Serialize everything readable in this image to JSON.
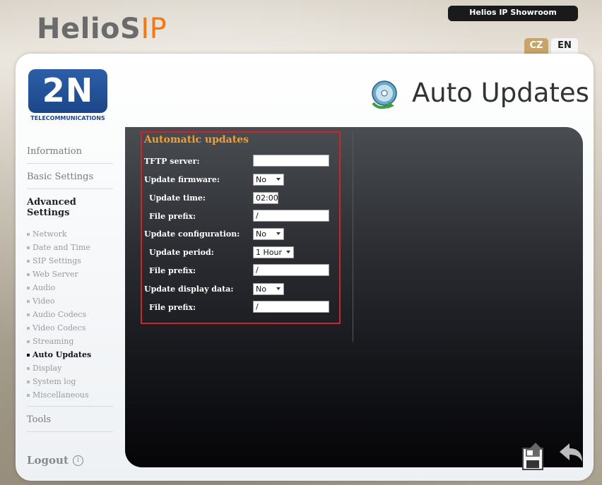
{
  "header": {
    "brand_main": "HelioS",
    "brand_ip": "IP",
    "device_name": "Helios IP Showroom",
    "languages": [
      {
        "code": "CZ",
        "active": false
      },
      {
        "code": "EN",
        "active": true
      }
    ]
  },
  "logo": {
    "text": "2N",
    "subtitle": "TELECOMMUNICATIONS"
  },
  "page": {
    "title": "Auto Updates",
    "title_icon": "cd-update-icon"
  },
  "nav": {
    "main": [
      {
        "label": "Information",
        "active": false
      },
      {
        "label": "Basic Settings",
        "active": false
      },
      {
        "label": "Advanced Settings",
        "active": true
      }
    ],
    "sub": [
      {
        "label": "Network",
        "active": false
      },
      {
        "label": "Date and Time",
        "active": false
      },
      {
        "label": "SIP Settings",
        "active": false
      },
      {
        "label": "Web Server",
        "active": false
      },
      {
        "label": "Audio",
        "active": false
      },
      {
        "label": "Video",
        "active": false
      },
      {
        "label": "Audio Codecs",
        "active": false
      },
      {
        "label": "Video Codecs",
        "active": false
      },
      {
        "label": "Streaming",
        "active": false
      },
      {
        "label": "Auto Updates",
        "active": true
      },
      {
        "label": "Display",
        "active": false
      },
      {
        "label": "System log",
        "active": false
      },
      {
        "label": "Miscellaneous",
        "active": false
      }
    ],
    "tools": "Tools",
    "logout": "Logout"
  },
  "form": {
    "heading": "Automatic updates",
    "tftp_server": {
      "label": "TFTP server:",
      "value": ""
    },
    "update_firmware": {
      "label": "Update firmware:",
      "value": "No"
    },
    "update_time": {
      "label": "Update time:",
      "value": "02:00"
    },
    "firmware_prefix": {
      "label": "File prefix:",
      "value": "/"
    },
    "update_configuration": {
      "label": "Update configuration:",
      "value": "No"
    },
    "update_period": {
      "label": "Update period:",
      "value": "1 Hour"
    },
    "config_prefix": {
      "label": "File prefix:",
      "value": "/"
    },
    "update_display": {
      "label": "Update display data:",
      "value": "No"
    },
    "display_prefix": {
      "label": "File prefix:",
      "value": "/"
    }
  },
  "colors": {
    "accent": "#f07a1a",
    "heading": "#f0a035",
    "highlight_border": "#d0232a",
    "brand_blue": "#1d4689"
  }
}
